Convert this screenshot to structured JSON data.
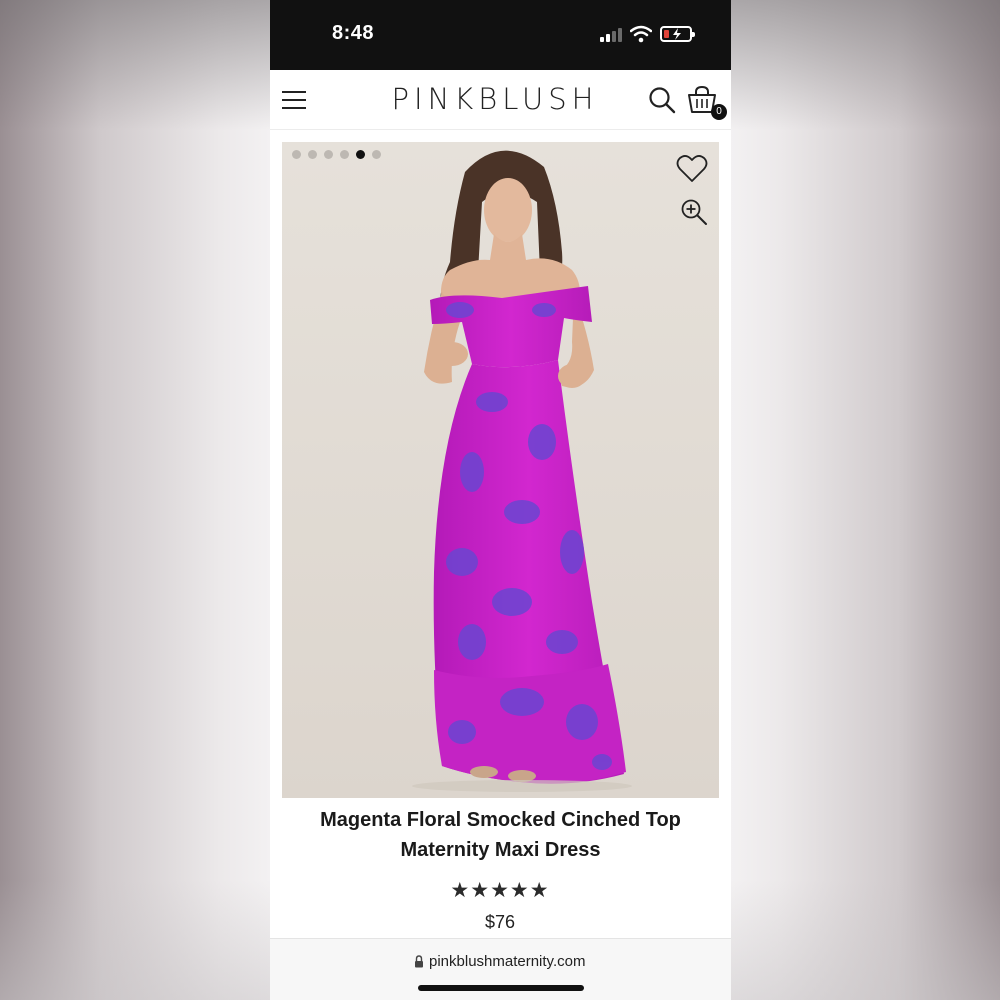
{
  "status_bar": {
    "time": "8:48",
    "icons": [
      "signal-icon",
      "wifi-icon",
      "battery-icon"
    ]
  },
  "header": {
    "brand": "PINKBLUSH",
    "cart_count": "0",
    "icons": [
      "menu-icon",
      "search-icon",
      "cart-icon"
    ]
  },
  "gallery": {
    "image_count": 6,
    "active_index": 4,
    "icons": [
      "heart-icon",
      "zoom-in-icon"
    ]
  },
  "product": {
    "title": "Magenta Floral Smocked Cinched Top Maternity Maxi Dress",
    "rating": 5,
    "rating_max": 5,
    "price": "$76"
  },
  "browser": {
    "url": "pinkblushmaternity.com",
    "icons": [
      "lock-icon"
    ]
  },
  "colors": {
    "accent_dress": "#c21fc4",
    "print_blue": "#6b45d1",
    "status_bar": "#111111",
    "background": "#e3ddd6"
  }
}
